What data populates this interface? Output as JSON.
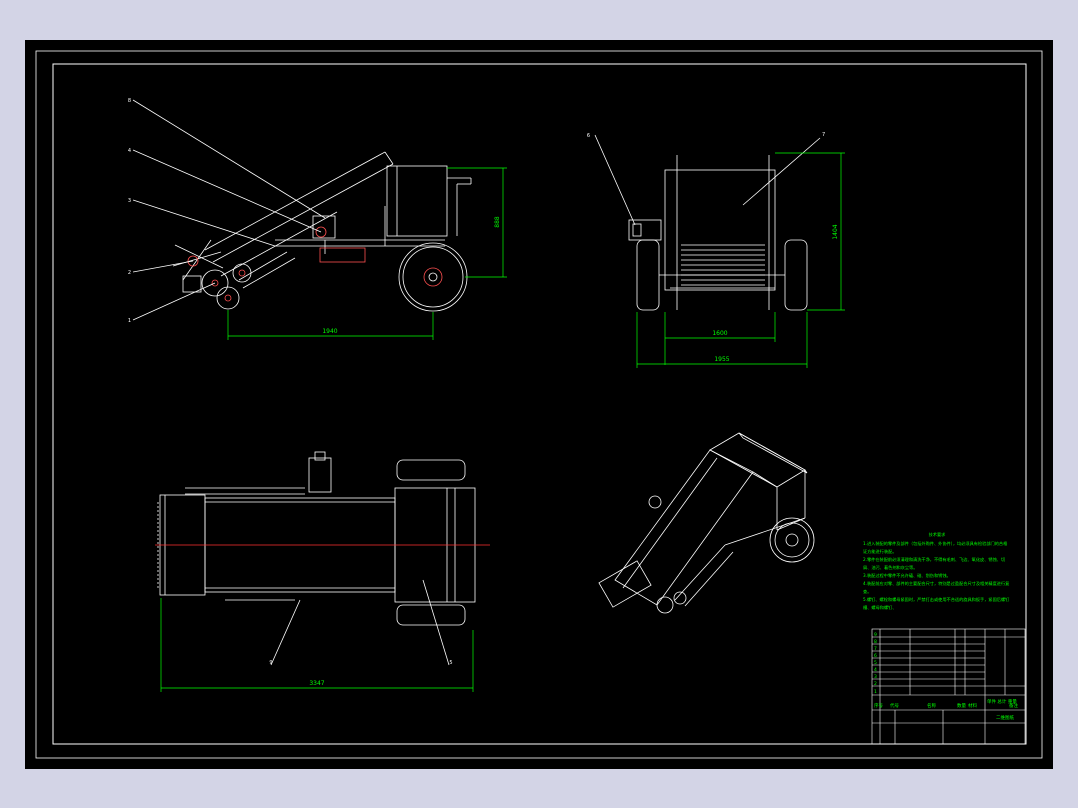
{
  "colors": {
    "background": "#d3d4e6",
    "canvas": "#000000",
    "linework": "#ffffff",
    "dimension": "#00ff00",
    "centerline": "#ff0000",
    "highlight": "#ff4040"
  },
  "side_view": {
    "balloons": [
      "8",
      "4",
      "3",
      "2",
      "1"
    ],
    "dim_height": "888",
    "dim_length": "1940"
  },
  "front_view": {
    "balloons": [
      "6",
      "7"
    ],
    "dim_height": "1404",
    "dim_inner_width": "1600",
    "dim_outer_width": "1955"
  },
  "top_view": {
    "balloons": [
      "9",
      "5"
    ],
    "dim_length": "3347"
  },
  "technical_requirements": {
    "title": "技术要求",
    "lines": [
      "1.进入装配的零件及部件（包括外购件、外协件），均必须具有检验部门的合格",
      "证方能进行装配。",
      "2.零件在装配前必须清理和清洗干净，不得有毛刺、飞边、氧化皮、锈蚀、切",
      "屑、油污、着色剂和灰尘等。",
      "3.装配过程中零件不允许磕、碰、划伤和锈蚀。",
      "4.装配前应对零、部件的主要配合尺寸，特别是过盈配合尺寸及相关精度进行复",
      "查。",
      "5.螺钉、螺栓和螺母紧固时，严禁打击或使用不合适的旋具和扳手，紧固后螺钉",
      "槽、螺母和螺钉、"
    ]
  },
  "title_block": {
    "headers": [
      "序号",
      "代号",
      "名称",
      "数量",
      "材料",
      "单件 总计 重量",
      "备注"
    ],
    "drawing_name": "二维图纸",
    "rows_left": [
      "9",
      "8",
      "7",
      "6",
      "5",
      "4",
      "3",
      "2",
      "1"
    ]
  }
}
